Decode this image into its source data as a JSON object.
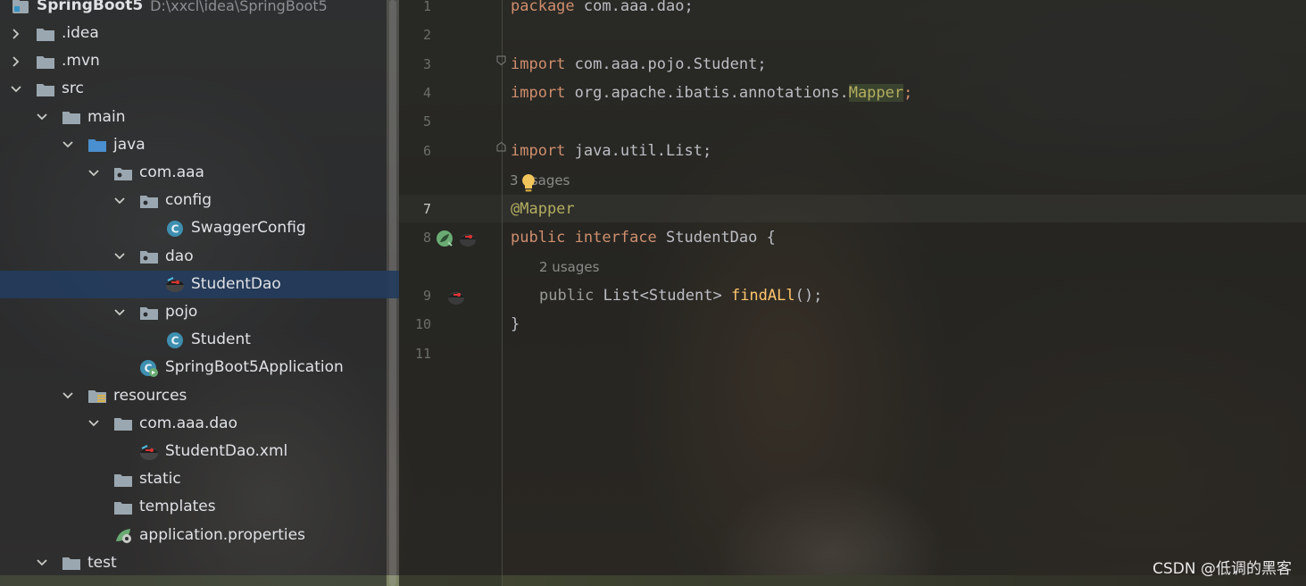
{
  "project_tree": {
    "root": {
      "name": "SpringBoot5",
      "path": "D:\\xxcl\\idea\\SpringBoot5"
    },
    "items": [
      {
        "label": ".idea",
        "indent": 0,
        "arrow": "right",
        "icon": "folder-icon"
      },
      {
        "label": ".mvn",
        "indent": 0,
        "arrow": "right",
        "icon": "folder-icon"
      },
      {
        "label": "src",
        "indent": 0,
        "arrow": "down",
        "icon": "folder-icon"
      },
      {
        "label": "main",
        "indent": 1,
        "arrow": "down",
        "icon": "folder-icon"
      },
      {
        "label": "java",
        "indent": 2,
        "arrow": "down",
        "icon": "source-folder-icon"
      },
      {
        "label": "com.aaa",
        "indent": 3,
        "arrow": "down",
        "icon": "package-icon"
      },
      {
        "label": "config",
        "indent": 4,
        "arrow": "down",
        "icon": "package-icon"
      },
      {
        "label": "SwaggerConfig",
        "indent": 5,
        "arrow": "none",
        "icon": "class-icon"
      },
      {
        "label": "dao",
        "indent": 4,
        "arrow": "down",
        "icon": "package-icon"
      },
      {
        "label": "StudentDao",
        "indent": 5,
        "arrow": "none",
        "icon": "mybatis-icon",
        "selected": true
      },
      {
        "label": "pojo",
        "indent": 4,
        "arrow": "down",
        "icon": "package-icon"
      },
      {
        "label": "Student",
        "indent": 5,
        "arrow": "none",
        "icon": "class-icon"
      },
      {
        "label": "SpringBoot5Application",
        "indent": 4,
        "arrow": "none",
        "icon": "spring-app-icon"
      },
      {
        "label": "resources",
        "indent": 2,
        "arrow": "down",
        "icon": "resources-folder-icon"
      },
      {
        "label": "com.aaa.dao",
        "indent": 3,
        "arrow": "down",
        "icon": "folder-icon"
      },
      {
        "label": "StudentDao.xml",
        "indent": 4,
        "arrow": "none",
        "icon": "mybatis-icon"
      },
      {
        "label": "static",
        "indent": 3,
        "arrow": "none",
        "icon": "folder-icon"
      },
      {
        "label": "templates",
        "indent": 3,
        "arrow": "none",
        "icon": "folder-icon"
      },
      {
        "label": "application.properties",
        "indent": 3,
        "arrow": "none",
        "icon": "properties-icon"
      },
      {
        "label": "test",
        "indent": 1,
        "arrow": "down",
        "icon": "folder-icon"
      }
    ]
  },
  "editor": {
    "line_numbers": [
      "1",
      "2",
      "3",
      "4",
      "5",
      "6",
      "7",
      "8",
      "9",
      "10",
      "11"
    ],
    "current_line": "7",
    "code": {
      "l1_kw": "package",
      "l1_rest": " com.aaa.dao;",
      "l3_kw": "import",
      "l3_rest": " com.aaa.pojo.Student;",
      "l4_kw": "import",
      "l4_rest": " org.apache.ibatis.annotations.",
      "l4_hl": "Mapper",
      "l4_end": ";",
      "l6_kw": "import",
      "l6_rest": " java.util.List;",
      "usages_1": "3 usages",
      "l7_ann": "@Mapper",
      "l8_kw1": "public",
      "l8_kw2": "interface",
      "l8_rest": " StudentDao {",
      "usages_2": "2 usages",
      "l9_kw": "public",
      "l9_type": " List<Student> ",
      "l9_method": "findALl",
      "l9_end": "();",
      "l10": "}"
    }
  },
  "watermark": "CSDN @低调的黑客"
}
